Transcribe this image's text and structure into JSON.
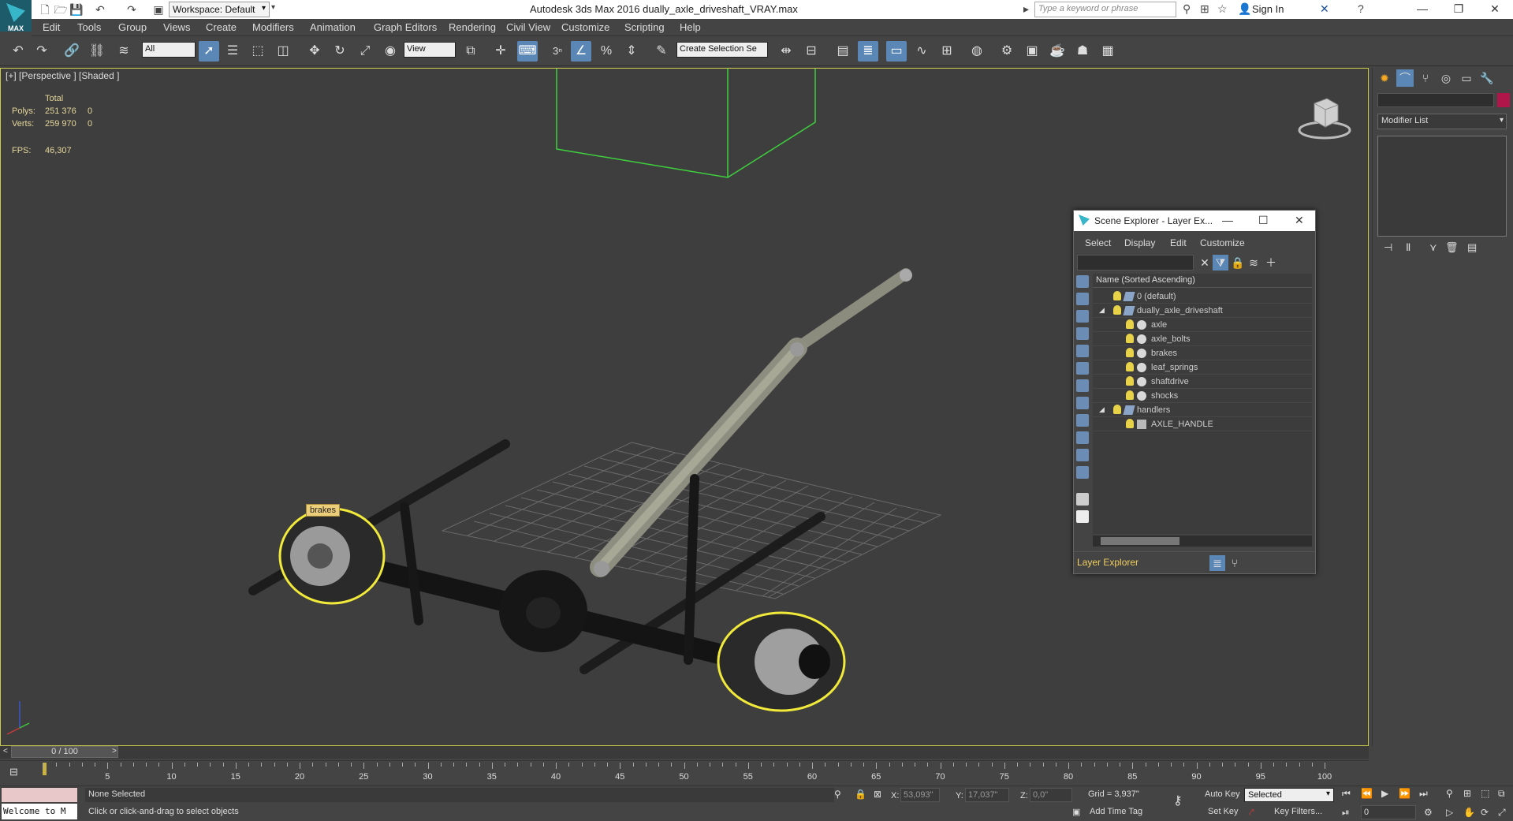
{
  "titlebar": {
    "logo_label": "MAX",
    "workspace": "Workspace: Default",
    "app_title": "Autodesk 3ds Max 2016     dually_axle_driveshaft_VRAY.max",
    "search_placeholder": "Type a keyword or phrase",
    "sign_in": "Sign In"
  },
  "menu": [
    "Edit",
    "Tools",
    "Group",
    "Views",
    "Create",
    "Modifiers",
    "Animation",
    "Graph Editors",
    "Rendering",
    "Civil View",
    "Customize",
    "Scripting",
    "Help"
  ],
  "toolbar": {
    "selection_filter": "All",
    "ref_coord": "View",
    "named_selection": "Create Selection Se",
    "snap_label": "3"
  },
  "viewport": {
    "label": "[+] [Perspective ] [Shaded ]",
    "stats": {
      "total_header": "Total",
      "polys_label": "Polys:",
      "polys_total": "251 376",
      "polys_sel": "0",
      "verts_label": "Verts:",
      "verts_total": "259 970",
      "verts_sel": "0",
      "fps_label": "FPS:",
      "fps_value": "46,307"
    },
    "tooltip": "brakes"
  },
  "scene_explorer": {
    "title": "Scene Explorer - Layer Ex...",
    "menus": [
      "Select",
      "Display",
      "Edit",
      "Customize"
    ],
    "column_header": "Name (Sorted Ascending)",
    "rows": [
      {
        "name": "0 (default)",
        "type": "layer",
        "level": 0
      },
      {
        "name": "dually_axle_driveshaft",
        "type": "layer",
        "level": 0,
        "expanded": true
      },
      {
        "name": "axle",
        "type": "object",
        "level": 1
      },
      {
        "name": "axle_bolts",
        "type": "object",
        "level": 1
      },
      {
        "name": "brakes",
        "type": "object",
        "level": 1
      },
      {
        "name": "leaf_springs",
        "type": "object",
        "level": 1
      },
      {
        "name": "shaftdrive",
        "type": "object",
        "level": 1
      },
      {
        "name": "shocks",
        "type": "object",
        "level": 1
      },
      {
        "name": "handlers",
        "type": "layer",
        "level": 0,
        "expanded": true
      },
      {
        "name": "AXLE_HANDLE",
        "type": "helper",
        "level": 1
      }
    ],
    "bottom_label": "Layer Explorer"
  },
  "command_panel": {
    "modifier_list": "Modifier List",
    "object_color": "#b0164a"
  },
  "timeline": {
    "slider": "0 / 100",
    "ticks": [
      5,
      10,
      15,
      20,
      25,
      30,
      35,
      40,
      45,
      50,
      55,
      60,
      65,
      70,
      75,
      80,
      85,
      90,
      95,
      100
    ]
  },
  "status": {
    "listener": "Welcome to M",
    "selection": "None Selected",
    "prompt": "Click or click-and-drag to select objects",
    "x_label": "X:",
    "x_value": "53,093\"",
    "y_label": "Y:",
    "y_value": "17,037\"",
    "z_label": "Z:",
    "z_value": "0,0\"",
    "grid": "Grid = 3,937\"",
    "add_time_tag": "Add Time Tag",
    "auto_key": "Auto Key",
    "set_key": "Set Key",
    "key_mode": "Selected",
    "key_filters": "Key Filters...",
    "frame": "0"
  },
  "colors": {
    "viewport_bg": "#3e3e3e",
    "selection_highlight": "#f2ea3a",
    "active_button": "#5b87b7"
  }
}
